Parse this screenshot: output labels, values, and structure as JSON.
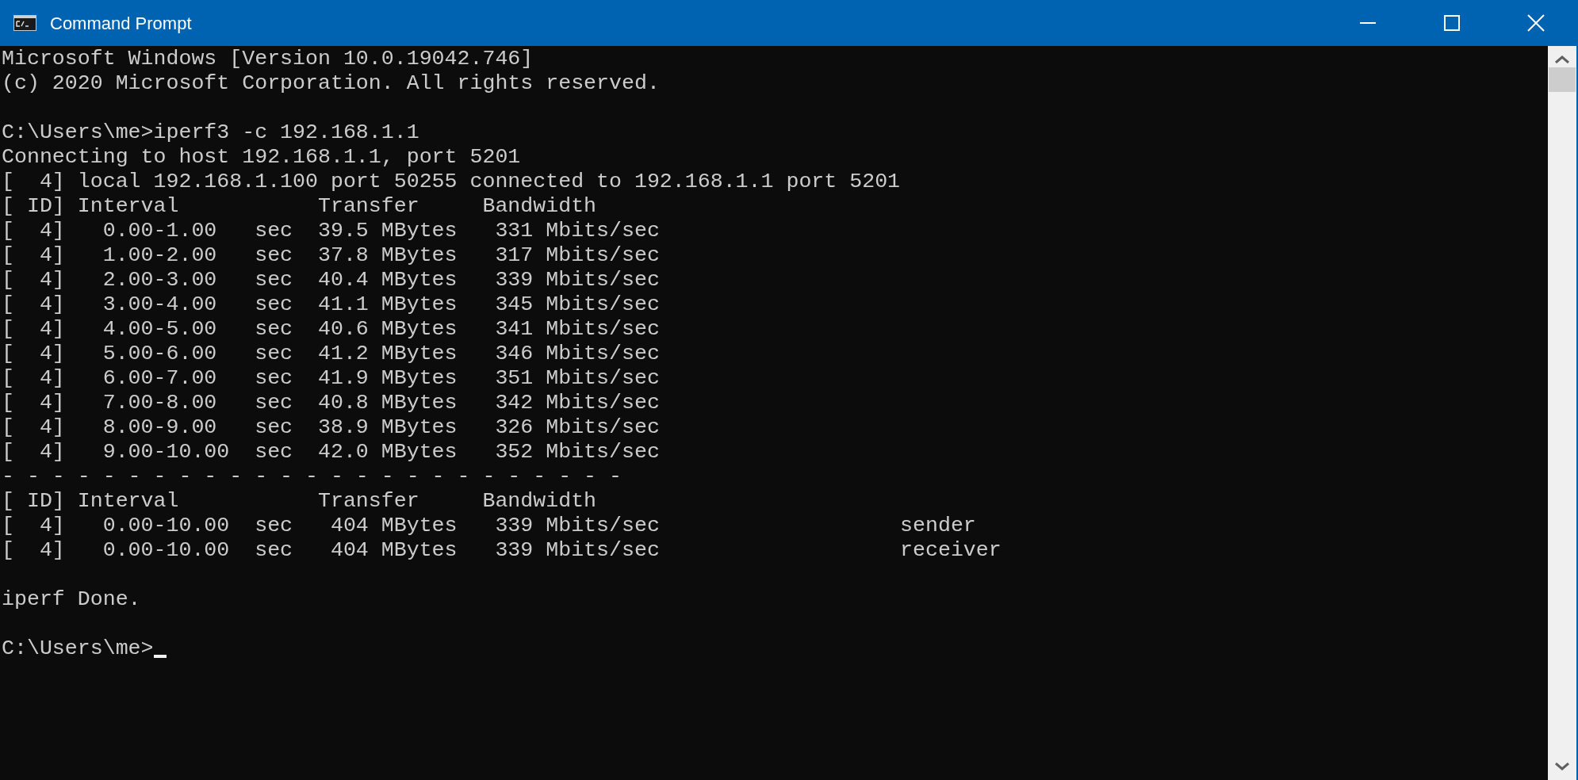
{
  "window": {
    "title": "Command Prompt"
  },
  "console": {
    "lines": [
      {
        "kind": "text",
        "text": "Microsoft Windows [Version 10.0.19042.746]"
      },
      {
        "kind": "text",
        "text": "(c) 2020 Microsoft Corporation. All rights reserved."
      },
      {
        "kind": "blank"
      },
      {
        "kind": "text",
        "text": "C:\\Users\\me>iperf3 -c 192.168.1.1"
      },
      {
        "kind": "text",
        "text": "Connecting to host 192.168.1.1, port 5201"
      },
      {
        "kind": "text",
        "text": "[  4] local 192.168.1.100 port 50255 connected to 192.168.1.1 port 5201"
      },
      {
        "kind": "text",
        "text": "[ ID] Interval           Transfer     Bandwidth"
      },
      {
        "kind": "text",
        "text": "[  4]   0.00-1.00   sec  39.5 MBytes   331 Mbits/sec"
      },
      {
        "kind": "text",
        "text": "[  4]   1.00-2.00   sec  37.8 MBytes   317 Mbits/sec"
      },
      {
        "kind": "text",
        "text": "[  4]   2.00-3.00   sec  40.4 MBytes   339 Mbits/sec"
      },
      {
        "kind": "text",
        "text": "[  4]   3.00-4.00   sec  41.1 MBytes   345 Mbits/sec"
      },
      {
        "kind": "text",
        "text": "[  4]   4.00-5.00   sec  40.6 MBytes   341 Mbits/sec"
      },
      {
        "kind": "text",
        "text": "[  4]   5.00-6.00   sec  41.2 MBytes   346 Mbits/sec"
      },
      {
        "kind": "text",
        "text": "[  4]   6.00-7.00   sec  41.9 MBytes   351 Mbits/sec"
      },
      {
        "kind": "text",
        "text": "[  4]   7.00-8.00   sec  40.8 MBytes   342 Mbits/sec"
      },
      {
        "kind": "text",
        "text": "[  4]   8.00-9.00   sec  38.9 MBytes   326 Mbits/sec"
      },
      {
        "kind": "text",
        "text": "[  4]   9.00-10.00  sec  42.0 MBytes   352 Mbits/sec"
      },
      {
        "kind": "text",
        "text": "- - - - - - - - - - - - - - - - - - - - - - - - -"
      },
      {
        "kind": "text",
        "text": "[ ID] Interval           Transfer     Bandwidth"
      },
      {
        "kind": "text",
        "text": "[  4]   0.00-10.00  sec   404 MBytes   339 Mbits/sec                   sender"
      },
      {
        "kind": "text",
        "text": "[  4]   0.00-10.00  sec   404 MBytes   339 Mbits/sec                   receiver"
      },
      {
        "kind": "blank"
      },
      {
        "kind": "text",
        "text": "iperf Done."
      },
      {
        "kind": "blank"
      },
      {
        "kind": "prompt",
        "text": "C:\\Users\\me>"
      }
    ]
  }
}
